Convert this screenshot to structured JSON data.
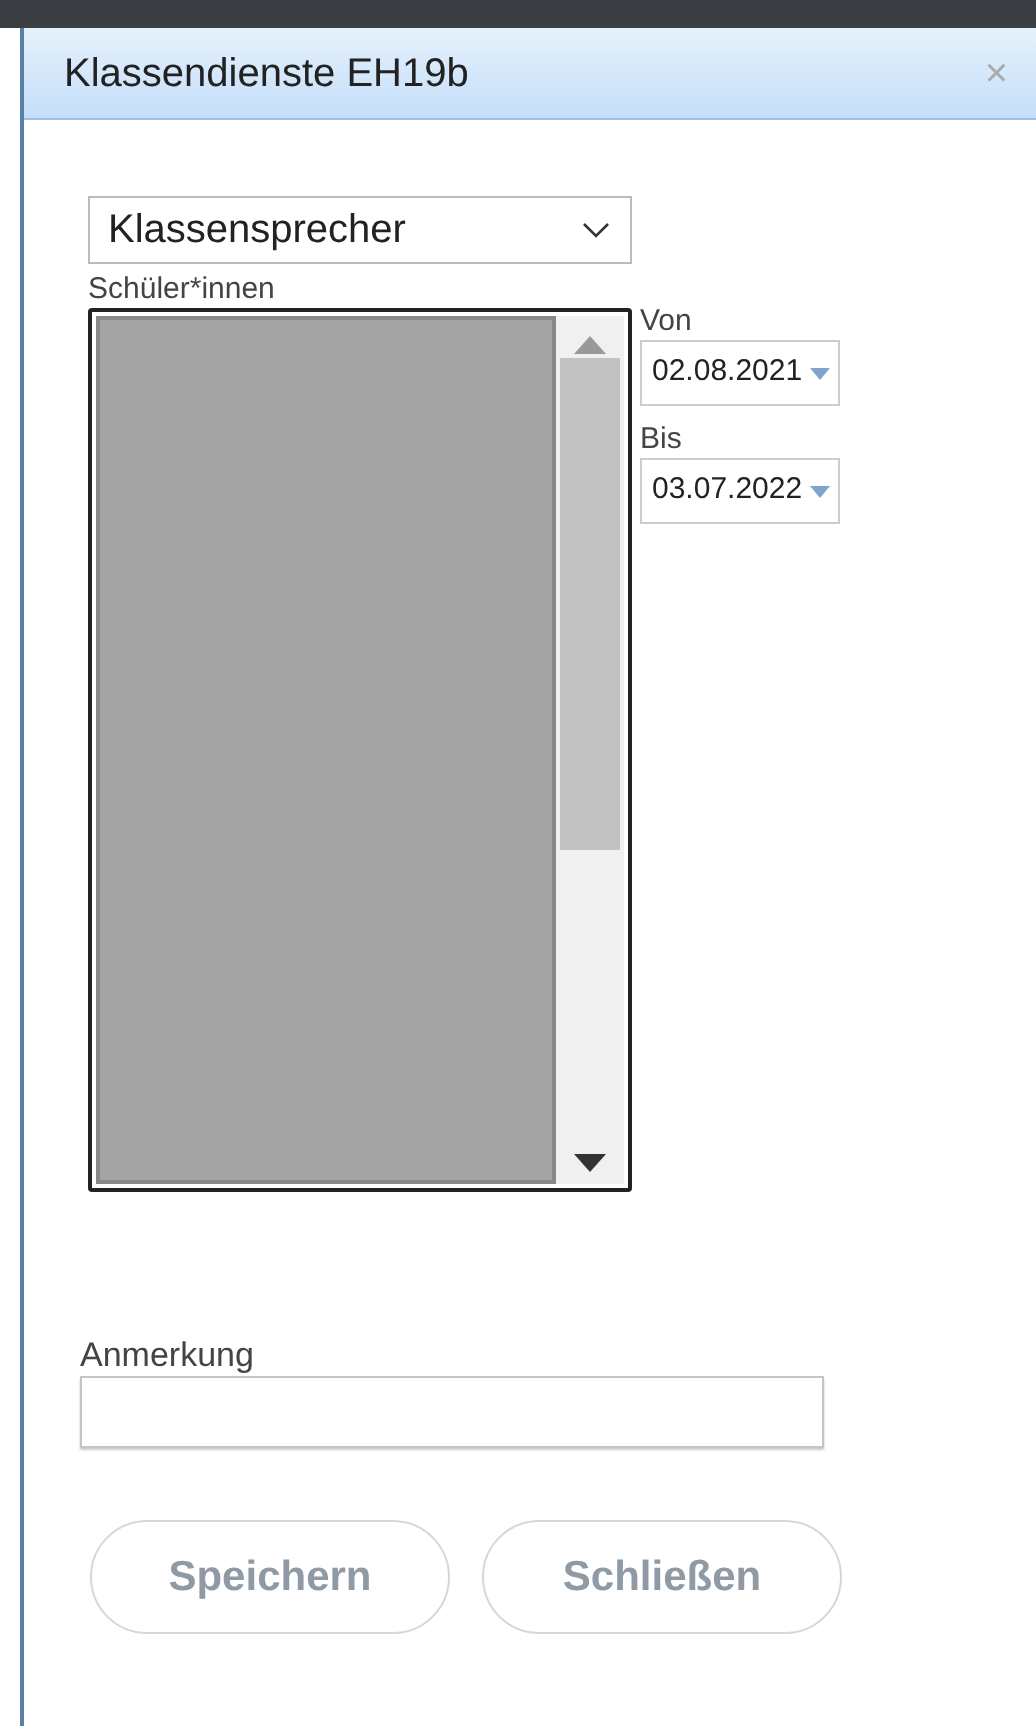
{
  "window": {
    "title": "Klassendienste EH19b",
    "close": "×"
  },
  "service_select": {
    "value": "Klassensprecher"
  },
  "students": {
    "label": "Schüler*innen"
  },
  "from": {
    "label": "Von",
    "value": "02.08.2021"
  },
  "to": {
    "label": "Bis",
    "value": "03.07.2022"
  },
  "note": {
    "label": "Anmerkung"
  },
  "buttons": [
    {
      "label": "Speichern",
      "disabled": true
    },
    {
      "label": "Schließen",
      "disabled": true
    }
  ]
}
